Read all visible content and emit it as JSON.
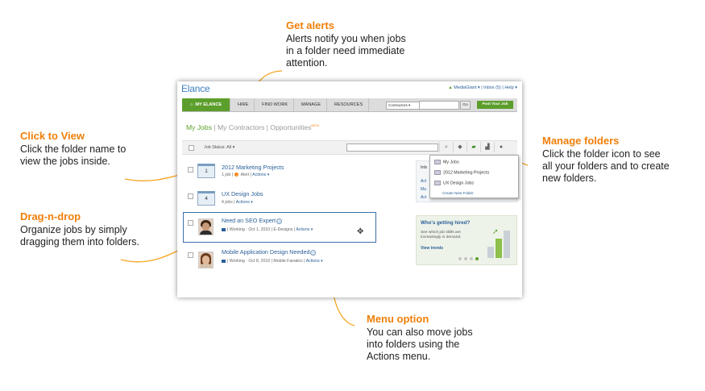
{
  "annotations": {
    "get_alerts": {
      "title": "Get alerts",
      "text": "Alerts notify you when jobs\nin a folder need immediate\nattention."
    },
    "click_to_view": {
      "title": "Click to View",
      "text": "Click the folder name to\nview the jobs inside."
    },
    "drag_n_drop": {
      "title": "Drag-n-drop",
      "text": "Organize jobs by simply\ndragging them into folders."
    },
    "manage_folders": {
      "title": "Manage folders",
      "text": "Click the folder icon to see\nall your folders and to create\nnew folders."
    },
    "menu_option": {
      "title": "Menu option",
      "text": "You can also move jobs\ninto folders using the\nActions menu."
    }
  },
  "app": {
    "logo": "Elance",
    "top_links": {
      "user": "MediaGiant ▾",
      "inbox": "Inbox (5)",
      "help": "Help ▾"
    }
  },
  "nav": {
    "items": [
      "MY ELANCE",
      "HIRE",
      "FIND WORK",
      "MANAGE",
      "RESOURCES"
    ],
    "contractors_select": "Contractors ▾",
    "go": "Go",
    "post_job": "Post Your Job"
  },
  "tabs": {
    "my_jobs": "My Jobs",
    "sep1": " | ",
    "contractors": "My Contractors",
    "sep2": " | ",
    "opportunities": "Opportunities",
    "beta": "BETA"
  },
  "filter": {
    "label": "Job Status:",
    "value": "All ▾"
  },
  "rows": [
    {
      "type": "folder",
      "count": "1",
      "title": "2012 Marketing Projects",
      "jobs": "1 job",
      "alert_count": "1",
      "alert": "Alert",
      "actions": "Actions ▾"
    },
    {
      "type": "folder",
      "count": "4",
      "title": "UX Design Jobs",
      "jobs": "4 jobs",
      "actions": "Actions ▾"
    },
    {
      "type": "job",
      "title": "Need an SEO Expert",
      "status": "Working",
      "date": "Oct 1, 2010",
      "company": "E-Designs",
      "actions": "Actions ▾",
      "move_icon": "✥"
    },
    {
      "type": "job",
      "title": "Mobile Application Design Needed",
      "status": "Working",
      "date": "Oct 8, 2010",
      "company": "Mobile Fanatics",
      "actions": "Actions ▾"
    }
  ],
  "sidebar_panel": {
    "title": "Inb",
    "links": [
      "Act",
      "Ma",
      "Act"
    ]
  },
  "folder_dropdown": {
    "items": [
      "My Jobs",
      "2012 Marketing Projects",
      "UX Design Jobs"
    ],
    "create": "Create New Folder"
  },
  "hired_panel": {
    "title": "Who's getting hired?",
    "text": "See which job skills are\nincreasingly in demand.",
    "link": "View trends"
  },
  "colors": {
    "accent": "#f07f0a",
    "brand_green": "#5c9e2b",
    "link_blue": "#2a5f98"
  }
}
